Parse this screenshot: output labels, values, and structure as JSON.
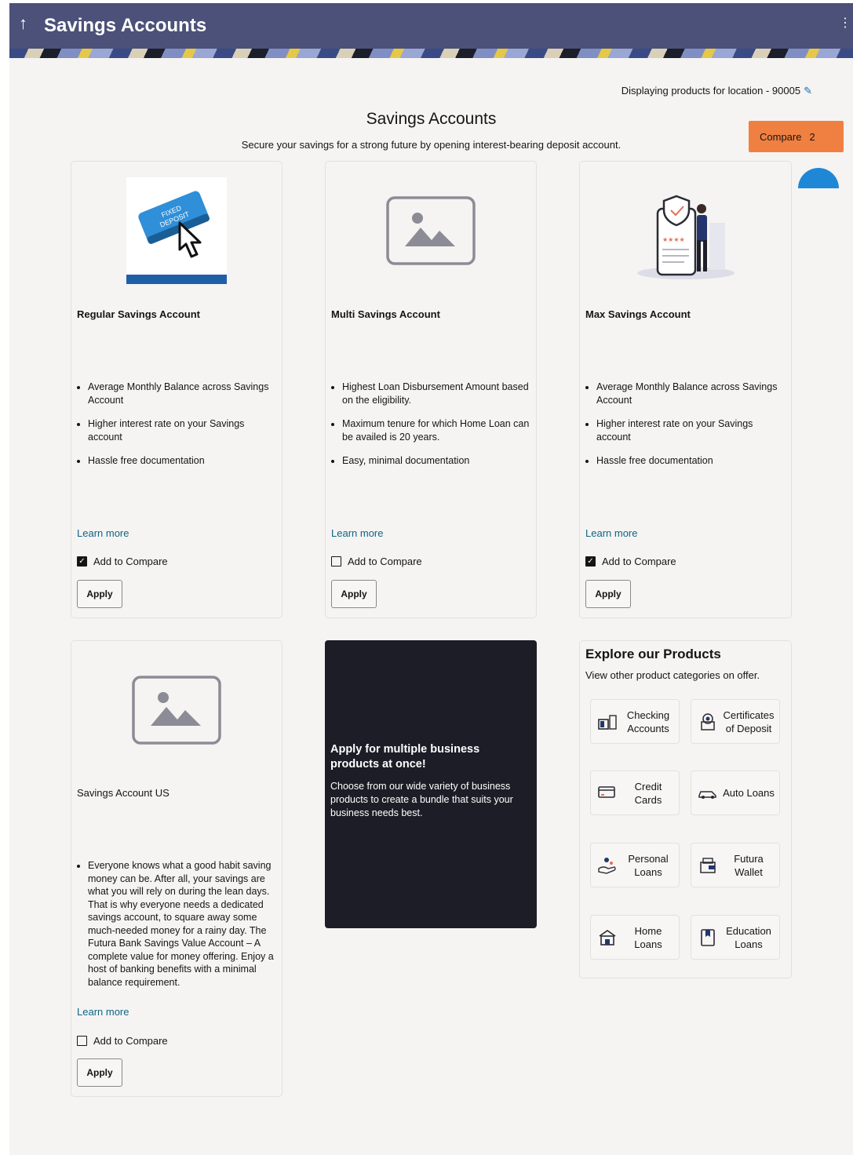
{
  "header": {
    "back_icon": "↑",
    "title": "Savings Accounts",
    "menu_icon": "⋮"
  },
  "location": {
    "label": "Displaying products for location - 90005",
    "edit_icon": "✎"
  },
  "page": {
    "title": "Savings Accounts",
    "subtitle": "Secure your savings for a strong future by opening interest-bearing deposit account."
  },
  "compare": {
    "label": "Compare",
    "count": "2"
  },
  "products": [
    {
      "name": "Regular Savings Account",
      "image": "fixed-deposit-photo",
      "features": [
        "Average Monthly Balance across Savings Account",
        "Higher interest rate on your Savings account",
        "Hassle free documentation"
      ],
      "learn_more": "Learn more",
      "compare_label": "Add to Compare",
      "compare_checked": true,
      "apply_label": "Apply"
    },
    {
      "name": "Multi Savings Account",
      "image": "image-placeholder",
      "features": [
        "Highest Loan Disbursement Amount based on the eligibility.",
        "Maximum tenure for which Home Loan can be availed is 20 years.",
        "Easy, minimal documentation"
      ],
      "learn_more": "Learn more",
      "compare_label": "Add to Compare",
      "compare_checked": false,
      "apply_label": "Apply"
    },
    {
      "name": "Max Savings Account",
      "image": "secure-phone-illustration",
      "features": [
        "Average Monthly Balance across Savings Account",
        "Higher interest rate on your Savings account",
        "Hassle free documentation"
      ],
      "learn_more": "Learn more",
      "compare_label": "Add to Compare",
      "compare_checked": true,
      "apply_label": "Apply"
    },
    {
      "name": "Savings Account US",
      "image": "image-placeholder",
      "features": [
        "Everyone knows what a good habit saving money can be. After all, your savings are what you will rely on during the lean days. That is why everyone needs a dedicated savings account, to square away some much-needed money for a rainy day. The Futura Bank Savings Value Account – A complete value for money offering. Enjoy a host of banking benefits with a minimal balance requirement."
      ],
      "learn_more": "Learn more",
      "compare_label": "Add to Compare",
      "compare_checked": false,
      "apply_label": "Apply"
    }
  ],
  "promo": {
    "heading": "Apply for multiple business products at once!",
    "text": "Choose from our wide variety of business products to create a bundle that suits your business needs best."
  },
  "explore": {
    "heading": "Explore our Products",
    "subheading": "View other product categories on offer.",
    "tiles": [
      {
        "label": "Checking Accounts",
        "icon": "checking-icon"
      },
      {
        "label": "Certificates of Deposit",
        "icon": "certificate-deposit-icon"
      },
      {
        "label": "Credit Cards",
        "icon": "credit-card-icon"
      },
      {
        "label": "Auto Loans",
        "icon": "car-icon"
      },
      {
        "label": "Personal Loans",
        "icon": "personal-loan-icon"
      },
      {
        "label": "Futura Wallet",
        "icon": "wallet-icon"
      },
      {
        "label": "Home Loans",
        "icon": "home-icon"
      },
      {
        "label": "Education Loans",
        "icon": "book-icon"
      }
    ]
  },
  "colors": {
    "header": "#4b5178",
    "compare": "#f08042",
    "link": "#0e6586",
    "promo": "#1c1d26",
    "fab": "#1e88d6"
  }
}
